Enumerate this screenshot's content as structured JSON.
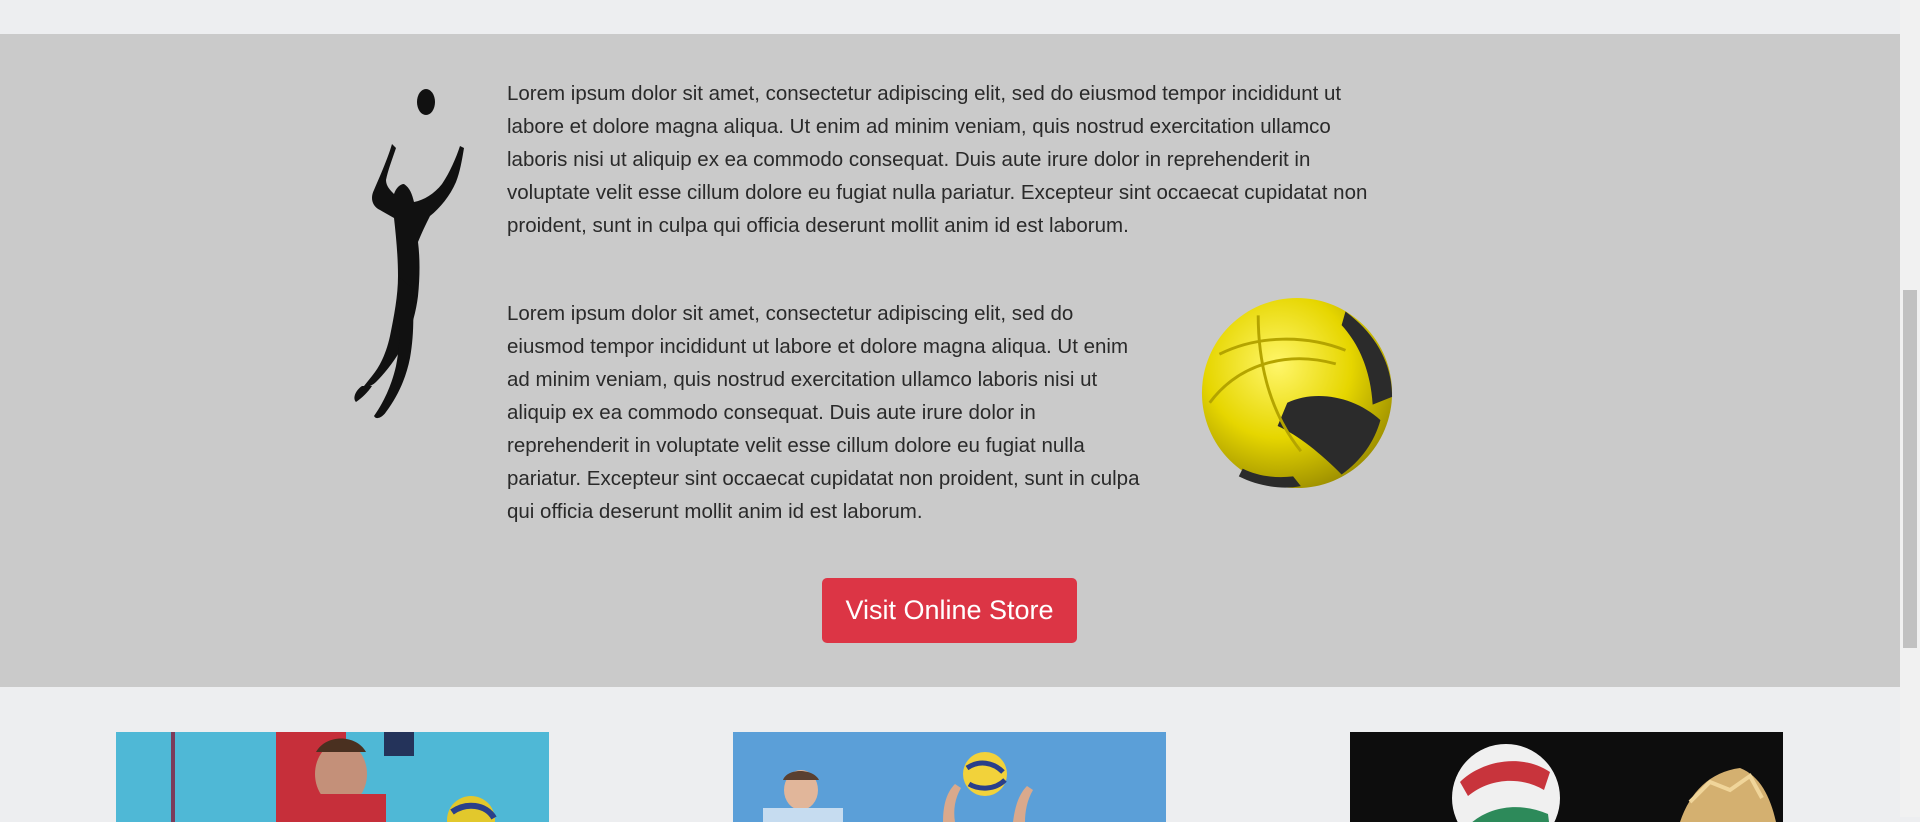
{
  "feature": {
    "paragraph_1": "Lorem ipsum dolor sit amet, consectetur adipiscing elit, sed do eiusmod tempor incididunt ut labore et dolore magna aliqua. Ut enim ad minim veniam, quis nostrud exercitation ullamco laboris nisi ut aliquip ex ea commodo consequat. Duis aute irure dolor in reprehenderit in voluptate velit esse cillum dolore eu fugiat nulla pariatur. Excepteur sint occaecat cupidatat non proident, sunt in culpa qui officia deserunt mollit anim id est laborum.",
    "paragraph_2": "Lorem ipsum dolor sit amet, consectetur adipiscing elit, sed do eiusmod tempor incididunt ut labore et dolore magna aliqua. Ut enim ad minim veniam, quis nostrud exercitation ullamco laboris nisi ut aliquip ex ea commodo consequat. Duis aute irure dolor in reprehenderit in voluptate velit esse cillum dolore eu fugiat nulla pariatur. Excepteur sint occaecat cupidatat non proident, sunt in culpa qui officia deserunt mollit anim id est laborum.",
    "cta_label": "Visit Online Store"
  },
  "colors": {
    "page_bg": "#edeef0",
    "feature_bg": "#cacaca",
    "cta_bg": "#dc3545",
    "ball_yellow": "#e6d600",
    "ball_dark": "#2b2b2b"
  },
  "gallery": [
    {
      "name": "volleyball-dig-photo"
    },
    {
      "name": "volleyball-set-photo"
    },
    {
      "name": "volleyball-spike-photo"
    }
  ]
}
